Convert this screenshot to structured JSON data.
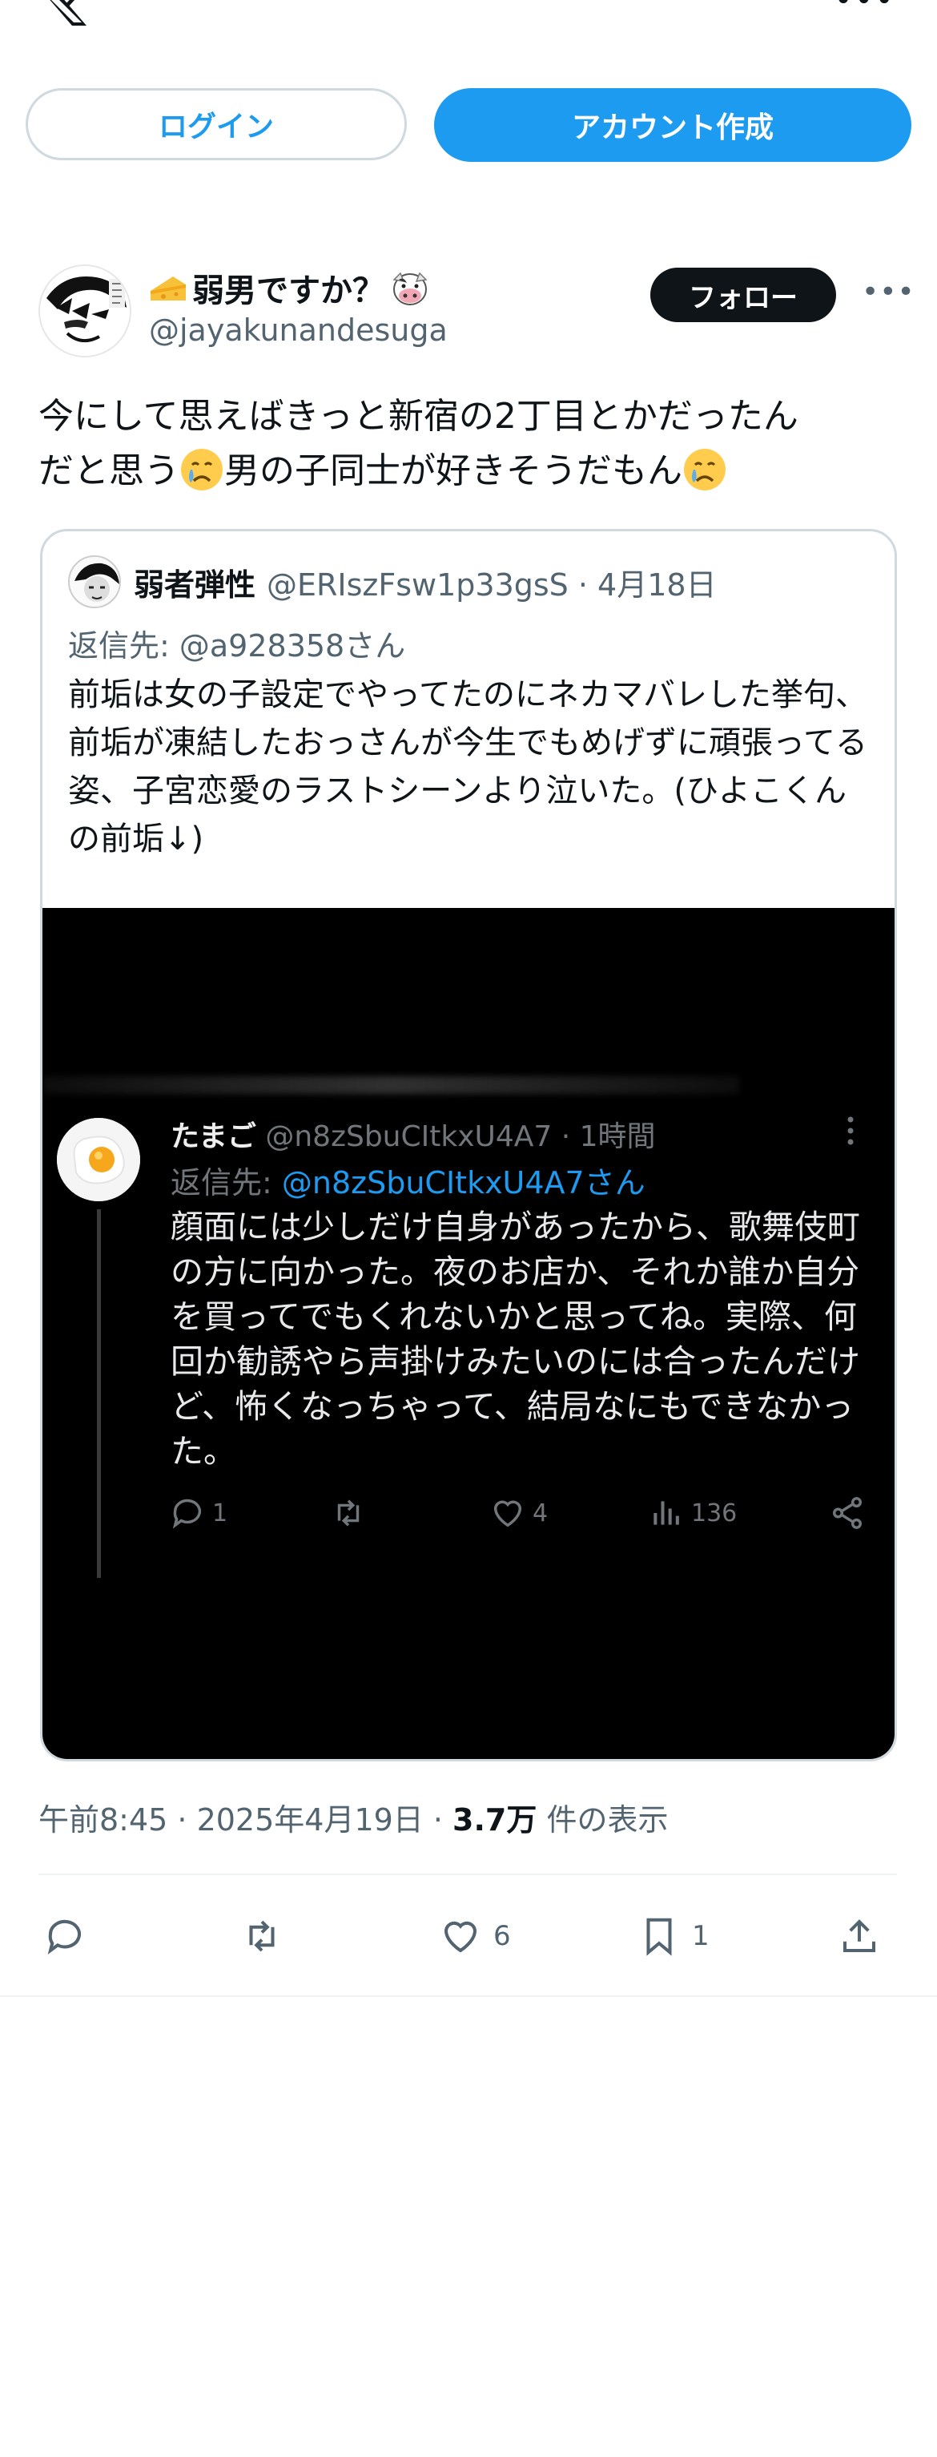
{
  "top_bar": {
    "logo_icon": "x-logo-icon",
    "more_label": "•••"
  },
  "auth": {
    "login_label": "ログイン",
    "signup_label": "アカウント作成"
  },
  "post": {
    "author_name": "弱男ですか？",
    "author_handle": "@jayakunandesuga",
    "follow_label": "フォロー",
    "more_label": "•••",
    "text_line1": "今にして思えばきっと新宿の2丁目とかだったん",
    "text_line2a": "だと思う",
    "text_line2b": "男の子同士が好きそうだもん",
    "timestamp": "午前8:45 · 2025年4月19日 · ",
    "views_count": "3.7万",
    "views_label": " 件の表示",
    "actions": {
      "like_count": "6",
      "bookmark_count": "1"
    }
  },
  "quote": {
    "name": "弱者弾性",
    "handle_date": "@ERIszFsw1p33gsS · 4月18日",
    "reply_to": "返信先: @a928358さん",
    "text": "前垢は女の子設定でやってたのにネカマバレした挙句、前垢が凍結したおっさんが今生でもめげずに頑張ってる姿、子宮恋愛のラストシーンより泣いた。(ひよこくんの前垢↓)"
  },
  "media": {
    "name": "たまご",
    "meta": " @n8zSbuCItkxU4A7 · 1時間",
    "reply_prefix": "返信先: ",
    "reply_link": "@n8zSbuCItkxU4A7さん",
    "text": "顔面には少しだけ自身があったから、歌舞伎町の方に向かった。夜のお店か、それか誰か自分を買ってでもくれないかと思ってね。実際、何回か勧誘やら声掛けみたいのには合ったんだけど、怖くなっちゃって、結局なにもできなかった。",
    "reply_count": "1",
    "like_count": "4",
    "view_count": "136"
  },
  "colors": {
    "accent": "#1d9bf0",
    "text": "#0f1419",
    "muted": "#536471",
    "border": "#cfd9de"
  }
}
